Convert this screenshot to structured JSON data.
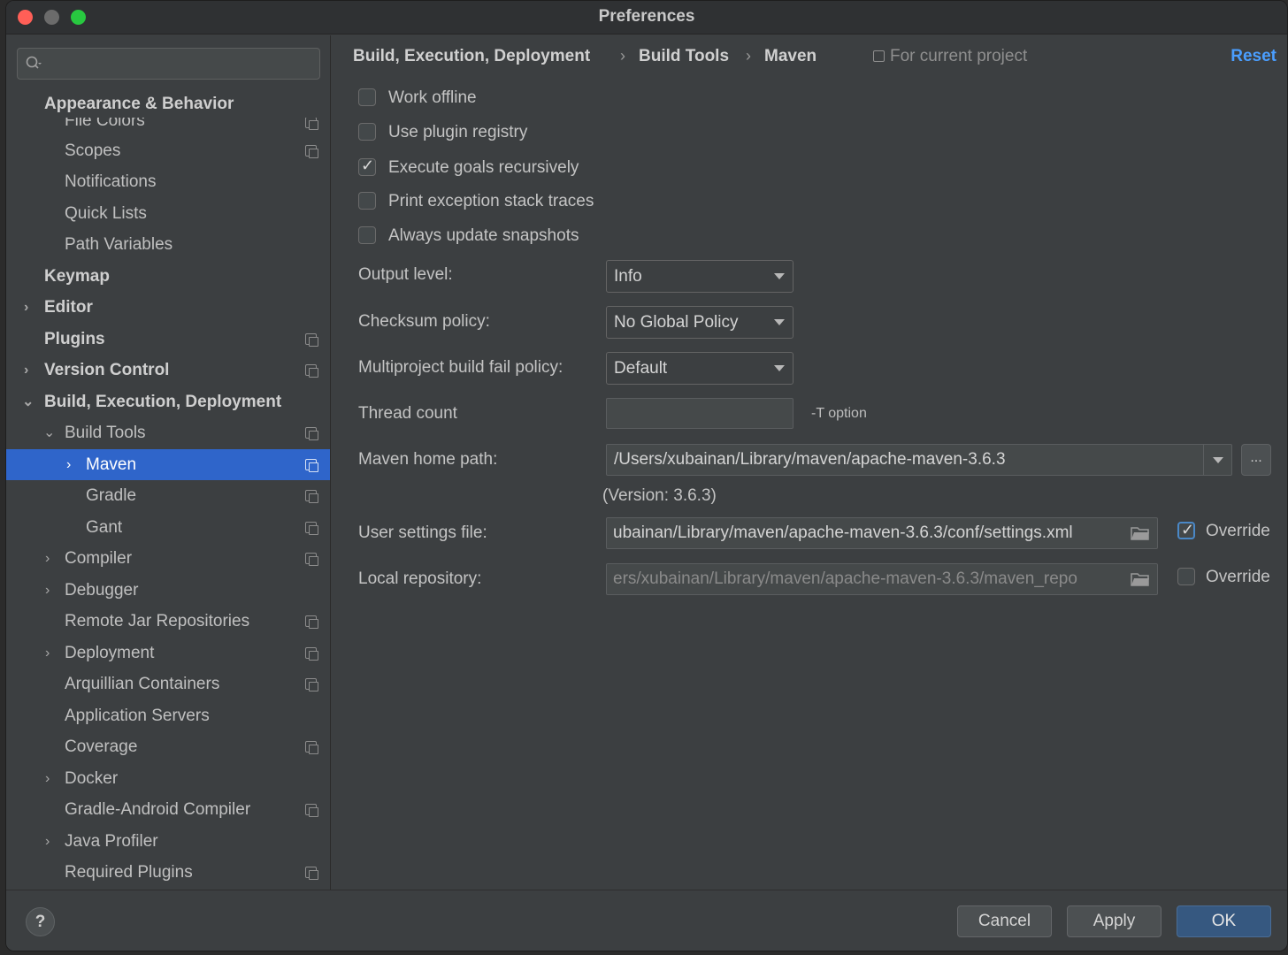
{
  "window": {
    "title": "Preferences"
  },
  "sidebar": {
    "search_placeholder": "",
    "items": [
      {
        "label": "Appearance & Behavior",
        "bold": true
      },
      {
        "label": "File Colors"
      },
      {
        "label": "Scopes"
      },
      {
        "label": "Notifications"
      },
      {
        "label": "Quick Lists"
      },
      {
        "label": "Path Variables"
      },
      {
        "label": "Keymap",
        "bold": true
      },
      {
        "label": "Editor",
        "bold": true
      },
      {
        "label": "Plugins",
        "bold": true
      },
      {
        "label": "Version Control",
        "bold": true
      },
      {
        "label": "Build, Execution, Deployment",
        "bold": true
      },
      {
        "label": "Build Tools"
      },
      {
        "label": "Maven",
        "selected": true
      },
      {
        "label": "Gradle"
      },
      {
        "label": "Gant"
      },
      {
        "label": "Compiler"
      },
      {
        "label": "Debugger"
      },
      {
        "label": "Remote Jar Repositories"
      },
      {
        "label": "Deployment"
      },
      {
        "label": "Arquillian Containers"
      },
      {
        "label": "Application Servers"
      },
      {
        "label": "Coverage"
      },
      {
        "label": "Docker"
      },
      {
        "label": "Gradle-Android Compiler"
      },
      {
        "label": "Java Profiler"
      },
      {
        "label": "Required Plugins"
      }
    ]
  },
  "header": {
    "breadcrumb": [
      "Build, Execution, Deployment",
      "Build Tools",
      "Maven"
    ],
    "scope": "For current project",
    "reset": "Reset"
  },
  "options": {
    "work_offline": {
      "label": "Work offline",
      "checked": false
    },
    "use_plugin_registry": {
      "label": "Use plugin registry",
      "checked": false
    },
    "execute_goals_recursively": {
      "label": "Execute goals recursively",
      "checked": true
    },
    "print_exception_stack_traces": {
      "label": "Print exception stack traces",
      "checked": false
    },
    "always_update_snapshots": {
      "label": "Always update snapshots",
      "checked": false
    }
  },
  "fields": {
    "output_level": {
      "label": "Output level:",
      "value": "Info"
    },
    "checksum_policy": {
      "label": "Checksum policy:",
      "value": "No Global Policy"
    },
    "multiproject_fail_policy": {
      "label": "Multiproject build fail policy:",
      "value": "Default"
    },
    "thread_count": {
      "label": "Thread count",
      "value": "",
      "hint": "-T option"
    },
    "maven_home": {
      "label": "Maven home path:",
      "value": "/Users/xubainan/Library/maven/apache-maven-3.6.3",
      "browse": "...",
      "version": "(Version: 3.6.3)"
    },
    "user_settings": {
      "label": "User settings file:",
      "value": "ubainan/Library/maven/apache-maven-3.6.3/conf/settings.xml",
      "override_label": "Override",
      "override": true
    },
    "local_repository": {
      "label": "Local repository:",
      "value": "ers/xubainan/Library/maven/apache-maven-3.6.3/maven_repo",
      "override_label": "Override",
      "override": false
    }
  },
  "footer": {
    "help": "?",
    "cancel": "Cancel",
    "apply": "Apply",
    "ok": "OK"
  },
  "colors": {
    "selection": "#2f65ca",
    "link": "#4a9eff",
    "ok_button": "#365880"
  }
}
